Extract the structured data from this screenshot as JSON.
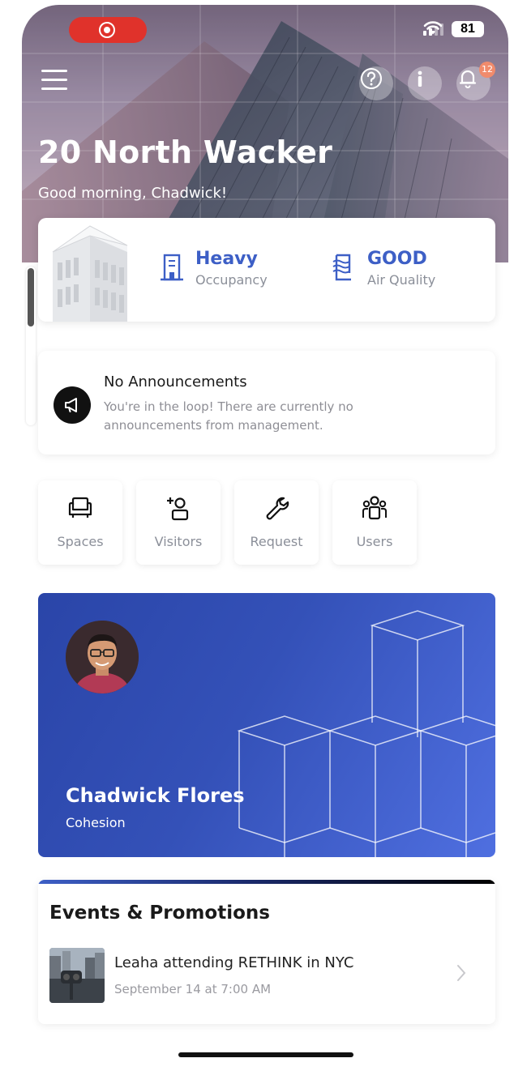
{
  "status_bar": {
    "battery": "81"
  },
  "header": {
    "notification_count": "12",
    "building_name": "20 North Wacker",
    "greeting": "Good morning, Chadwick!"
  },
  "stats": {
    "occupancy_value": "Heavy",
    "occupancy_label": "Occupancy",
    "air_value": "GOOD",
    "air_label": "Air Quality"
  },
  "announcement": {
    "title": "No Announcements",
    "text": "You're in the loop! There are currently no announcements from management."
  },
  "quick_actions": [
    {
      "label": "Spaces",
      "icon": "sofa-icon"
    },
    {
      "label": "Visitors",
      "icon": "add-visitor-icon"
    },
    {
      "label": "Request",
      "icon": "wrench-icon"
    },
    {
      "label": "Users",
      "icon": "users-icon"
    }
  ],
  "profile": {
    "name": "Chadwick Flores",
    "company": "Cohesion"
  },
  "events": {
    "title": "Events & Promotions",
    "items": [
      {
        "name": "Leaha attending RETHINK in NYC",
        "date": "September 14 at 7:00 AM"
      }
    ]
  },
  "colors": {
    "accent": "#3d5fc6",
    "profile_bg": "#3451b8",
    "record": "#e0322b",
    "badge": "#f08b6c"
  }
}
